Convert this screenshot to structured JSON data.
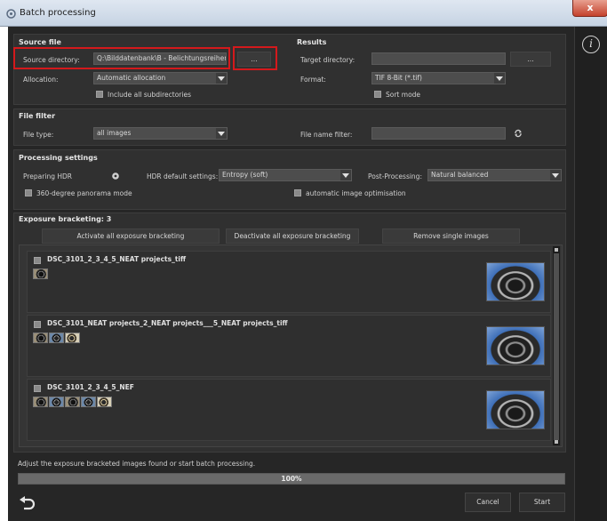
{
  "window": {
    "title": "Batch processing",
    "close_glyph": "x"
  },
  "source_file": {
    "title": "Source file",
    "source_directory_label": "Source directory:",
    "source_directory_value": "Q:\\Bilddatenbank\\B - Belichtungsreihen",
    "browse_label": "...",
    "allocation_label": "Allocation:",
    "allocation_value": "Automatic allocation",
    "include_subdirectories_label": "Include all subdirectories"
  },
  "results": {
    "title": "Results",
    "target_directory_label": "Target directory:",
    "target_directory_value": "",
    "browse_label": "...",
    "format_label": "Format:",
    "format_value": "TIF 8-Bit (*.tif)",
    "sort_mode_label": "Sort mode"
  },
  "file_filter": {
    "title": "File filter",
    "file_type_label": "File type:",
    "file_type_value": "all images",
    "file_name_filter_label": "File name filter:",
    "file_name_filter_value": ""
  },
  "processing": {
    "title": "Processing settings",
    "preparing_hdr_label": "Preparing HDR",
    "hdr_default_label": "HDR default settings:",
    "hdr_default_value": "Entropy (soft)",
    "post_processing_label": "Post-Processing:",
    "post_processing_value": "Natural balanced",
    "panorama_label": "360-degree panorama mode",
    "auto_optimisation_label": "automatic image optimisation"
  },
  "bracketing": {
    "title": "Exposure bracketing: 3",
    "activate_all": "Activate all exposure bracketing",
    "deactivate_all": "Deactivate all exposure bracketing",
    "remove_single": "Remove single images",
    "items": [
      {
        "name": "DSC_3101_2_3_4_5_NEAT projects_tiff",
        "thumb_count": 1
      },
      {
        "name": "DSC_3101_NEAT projects_2_NEAT projects___5_NEAT projects_tiff",
        "thumb_count": 3
      },
      {
        "name": "DSC_3101_2_3_4_5_NEF",
        "thumb_count": 5
      }
    ]
  },
  "status_text": "Adjust the exposure bracketed images found or start batch processing.",
  "progress": {
    "value": 1.0,
    "label": "100%"
  },
  "buttons": {
    "cancel": "Cancel",
    "start": "Start"
  },
  "info_glyph": "i",
  "colors": {
    "highlight": "#d4191c",
    "panel": "#303030",
    "background": "#262626"
  }
}
